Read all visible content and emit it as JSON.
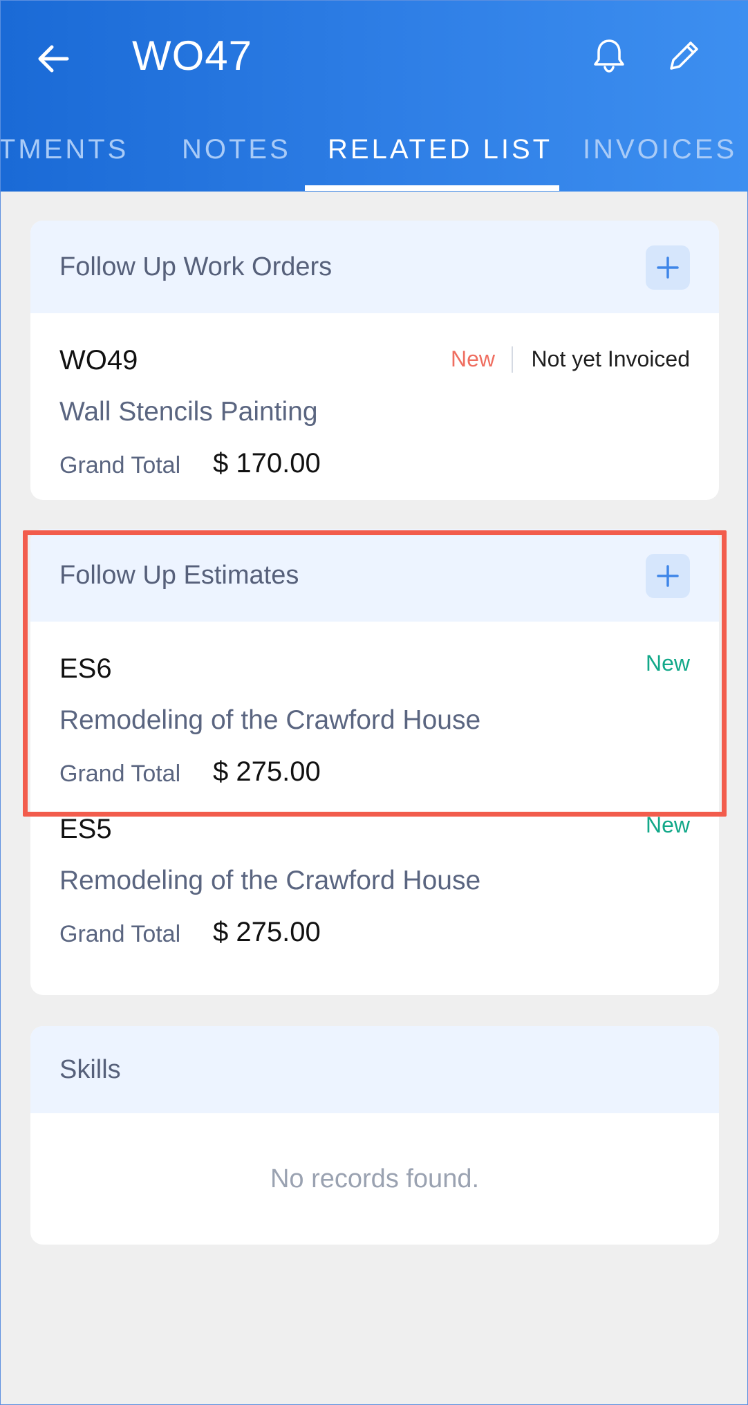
{
  "header": {
    "title": "WO47",
    "tabs": [
      {
        "label": "NTMENTS",
        "active": false
      },
      {
        "label": "NOTES",
        "active": false
      },
      {
        "label": "RELATED LIST",
        "active": true
      },
      {
        "label": "INVOICES",
        "active": false
      }
    ],
    "icons": {
      "back": "arrow-left-icon",
      "notifications": "bell-icon",
      "edit": "pencil-icon"
    },
    "colors": {
      "gradient_start": "#1a6ad6",
      "gradient_end": "#3d8ff0"
    }
  },
  "sections": {
    "work_orders": {
      "title": "Follow Up Work Orders",
      "add_icon": "plus-icon",
      "records": [
        {
          "id": "WO49",
          "status": "New",
          "billing_status": "Not yet Invoiced",
          "name": "Wall Stencils Painting",
          "total_label": "Grand Total",
          "total_value": "$ 170.00"
        }
      ]
    },
    "estimates": {
      "title": "Follow Up Estimates",
      "add_icon": "plus-icon",
      "records": [
        {
          "id": "ES6",
          "status": "New",
          "name": "Remodeling of the Crawford House",
          "total_label": "Grand Total",
          "total_value": "$ 275.00"
        },
        {
          "id": "ES5",
          "status": "New",
          "name": "Remodeling of the Crawford House",
          "total_label": "Grand Total",
          "total_value": "$ 275.00"
        }
      ]
    },
    "skills": {
      "title": "Skills",
      "empty_text": "No records found."
    }
  },
  "colors": {
    "status_new_work_order": "#ef6e60",
    "status_new_estimate": "#12a889",
    "highlight_border": "#f25c4c",
    "section_header_bg": "#edf4ff"
  }
}
